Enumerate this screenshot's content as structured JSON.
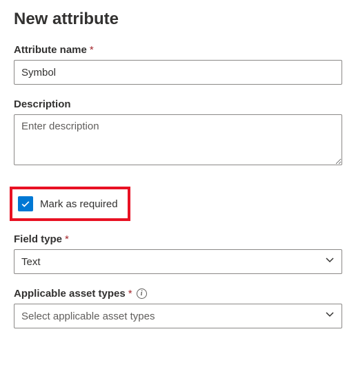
{
  "title": "New attribute",
  "attributeName": {
    "label": "Attribute name",
    "required": true,
    "value": "Symbol"
  },
  "description": {
    "label": "Description",
    "placeholder": "Enter description",
    "value": ""
  },
  "markRequired": {
    "label": "Mark as required",
    "checked": true
  },
  "fieldType": {
    "label": "Field type",
    "required": true,
    "value": "Text"
  },
  "assetTypes": {
    "label": "Applicable asset types",
    "required": true,
    "placeholder": "Select applicable asset types"
  }
}
